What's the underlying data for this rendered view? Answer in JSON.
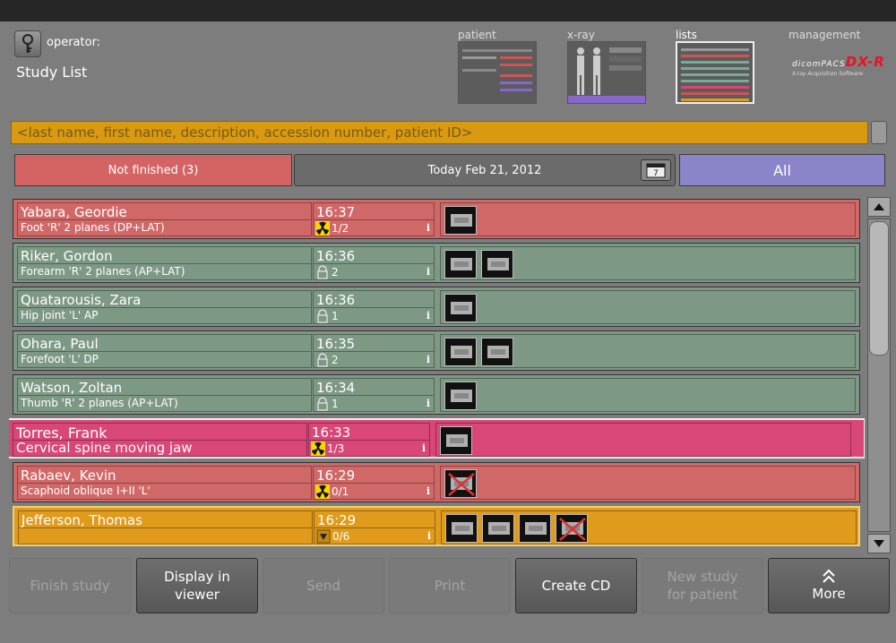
{
  "header": {
    "operator_label": "operator:",
    "title": "Study List",
    "nav_tabs": [
      {
        "label": "patient",
        "active": false
      },
      {
        "label": "x-ray",
        "active": false
      },
      {
        "label": "lists",
        "active": true
      }
    ],
    "management_label": "management",
    "logo": {
      "brand": "dicomPACS",
      "product": "DX-R",
      "tagline": "X-ray Acquisition Software"
    }
  },
  "search": {
    "placeholder": "<last name, first name, description, accession number, patient ID>"
  },
  "filters": {
    "not_finished": "Not finished (3)",
    "date": "Today Feb 21, 2012",
    "all": "All"
  },
  "studies": [
    {
      "name": "Yabara, Geordie",
      "desc": "Foot 'R' 2 planes (DP+LAT)",
      "time": "16:37",
      "count": "1/2",
      "status": "radiation",
      "color": "red",
      "thumbs": 1
    },
    {
      "name": "Riker, Gordon",
      "desc": "Forearm 'R' 2 planes (AP+LAT)",
      "time": "16:36",
      "count": "2",
      "status": "locked",
      "color": "green",
      "thumbs": 2
    },
    {
      "name": "Quatarousis, Zara",
      "desc": "Hip joint 'L' AP",
      "time": "16:36",
      "count": "1",
      "status": "locked",
      "color": "green",
      "thumbs": 1
    },
    {
      "name": "Ohara, Paul",
      "desc": "Forefoot 'L' DP",
      "time": "16:35",
      "count": "2",
      "status": "locked",
      "color": "green",
      "thumbs": 2
    },
    {
      "name": "Watson, Zoltan",
      "desc": "Thumb 'R' 2 planes (AP+LAT)",
      "time": "16:34",
      "count": "1",
      "status": "locked",
      "color": "green",
      "thumbs": 1
    },
    {
      "name": "Torres, Frank",
      "desc": "Cervical spine moving jaw",
      "time": "16:33",
      "count": "1/3",
      "status": "radiation",
      "color": "pink",
      "thumbs": 1
    },
    {
      "name": "Rabaev, Kevin",
      "desc": "Scaphoid oblique I+II 'L'",
      "time": "16:29",
      "count": "0/1",
      "status": "radiation",
      "color": "red",
      "thumbs": 1
    },
    {
      "name": "Jefferson, Thomas",
      "desc": "",
      "time": "16:29",
      "count": "0/6",
      "status": "pending",
      "color": "orange",
      "thumbs": 4
    }
  ],
  "info_glyph": "i",
  "buttons": [
    {
      "label": "Finish study",
      "enabled": false
    },
    {
      "label": "Display in viewer",
      "enabled": true
    },
    {
      "label": "Send",
      "enabled": false
    },
    {
      "label": "Print",
      "enabled": false
    },
    {
      "label": "Create CD",
      "enabled": true
    },
    {
      "label": "New study for patient",
      "enabled": false
    },
    {
      "label": "More",
      "enabled": true
    }
  ],
  "colors": {
    "red": "#d16868",
    "green": "#7e9886",
    "pink": "#d94778",
    "orange": "#e09a1c",
    "all": "#8a85c9",
    "search": "#d99a12"
  }
}
